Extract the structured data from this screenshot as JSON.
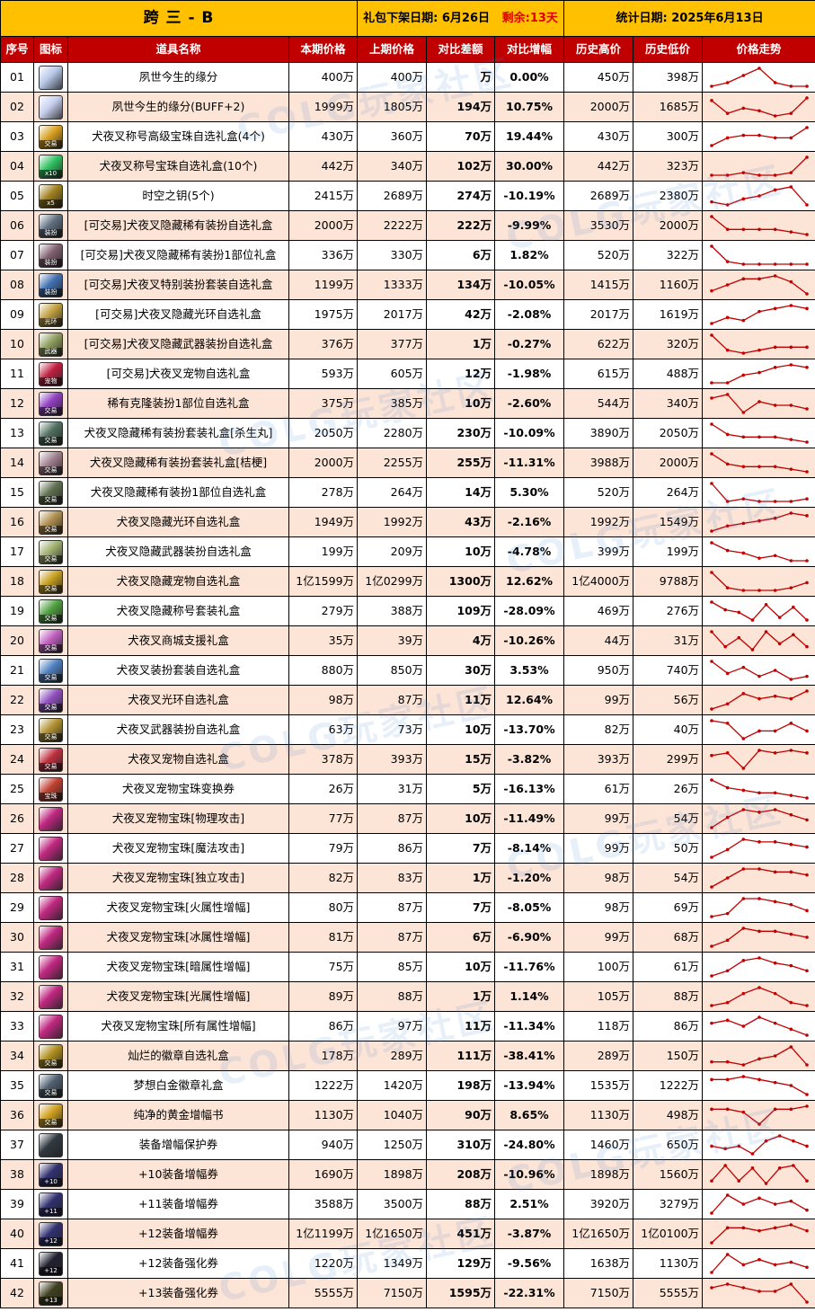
{
  "header": {
    "server": "跨 三 - B",
    "offline_label": "礼包下架日期:",
    "offline_date": "6月26日",
    "remaining_label": "剩余:",
    "remaining_value": "13天",
    "stat_label": "统计日期:",
    "stat_date": "2025年6月13日"
  },
  "columns": [
    "序号",
    "图标",
    "道具名称",
    "本期价格",
    "上期价格",
    "对比差额",
    "对比增幅",
    "历史高价",
    "历史低价",
    "价格走势"
  ],
  "watermark": "COLG玩家社区",
  "rows": [
    {
      "no": "01",
      "icon": "soul-bond-icon",
      "icon_color": "#b8c8e8",
      "tag": "",
      "name": "夙世今生的缘分",
      "cur": "400万",
      "prev": "400万",
      "diff": "万",
      "pct": "0.00%",
      "dir": "pos",
      "high": "450万",
      "low": "398万",
      "trend": [
        3,
        4,
        6,
        8,
        4,
        3,
        3
      ]
    },
    {
      "no": "02",
      "icon": "soul-bond-icon",
      "icon_color": "#c8d0f0",
      "tag": "",
      "name": "夙世今生的缘分(BUFF+2)",
      "cur": "1999万",
      "prev": "1805万",
      "diff": "194万",
      "pct": "10.75%",
      "dir": "pos",
      "high": "2000万",
      "low": "1685万",
      "trend": [
        8,
        3,
        5,
        4,
        2,
        3,
        9
      ]
    },
    {
      "no": "03",
      "icon": "title-gem-box-icon",
      "icon_color": "#d8a020",
      "tag": "交易",
      "name": "犬夜叉称号高级宝珠自选礼盒(4个)",
      "cur": "430万",
      "prev": "360万",
      "diff": "70万",
      "pct": "19.44%",
      "dir": "pos",
      "high": "430万",
      "low": "300万",
      "trend": [
        2,
        5,
        6,
        6,
        5,
        5,
        9
      ]
    },
    {
      "no": "04",
      "icon": "title-gem-box-icon",
      "icon_color": "#30c060",
      "tag": "x10",
      "name": "犬夜叉称号宝珠自选礼盒(10个)",
      "cur": "442万",
      "prev": "340万",
      "diff": "102万",
      "pct": "30.00%",
      "dir": "pos",
      "high": "442万",
      "low": "323万",
      "trend": [
        2,
        2,
        3,
        2,
        2,
        3,
        9
      ]
    },
    {
      "no": "05",
      "icon": "time-key-icon",
      "icon_color": "#a08020",
      "tag": "x5",
      "name": "时空之钥(5个)",
      "cur": "2415万",
      "prev": "2689万",
      "diff": "274万",
      "pct": "-10.19%",
      "dir": "neg",
      "high": "2689万",
      "low": "2380万",
      "trend": [
        3,
        2,
        4,
        5,
        7,
        8,
        2
      ]
    },
    {
      "no": "06",
      "icon": "rare-avatar-box-icon",
      "icon_color": "#607080",
      "tag": "装扮",
      "name": "[可交易]犬夜叉隐藏稀有装扮自选礼盒",
      "cur": "2000万",
      "prev": "2222万",
      "diff": "222万",
      "pct": "-9.99%",
      "dir": "neg",
      "high": "3530万",
      "low": "2000万",
      "trend": [
        9,
        4,
        4,
        4,
        4,
        3,
        2
      ]
    },
    {
      "no": "07",
      "icon": "rare-avatar-part-icon",
      "icon_color": "#806070",
      "tag": "装扮",
      "name": "[可交易]犬夜叉隐藏稀有装扮1部位礼盒",
      "cur": "336万",
      "prev": "330万",
      "diff": "6万",
      "pct": "1.82%",
      "dir": "pos",
      "high": "520万",
      "low": "322万",
      "trend": [
        9,
        3,
        2,
        2,
        2,
        2,
        2
      ]
    },
    {
      "no": "08",
      "icon": "special-avatar-box-icon",
      "icon_color": "#4070b0",
      "tag": "装扮",
      "name": "[可交易]犬夜叉特别装扮套装自选礼盒",
      "cur": "1199万",
      "prev": "1333万",
      "diff": "134万",
      "pct": "-10.05%",
      "dir": "neg",
      "high": "1415万",
      "low": "1160万",
      "trend": [
        3,
        5,
        7,
        7,
        8,
        6,
        2
      ]
    },
    {
      "no": "09",
      "icon": "aura-box-icon",
      "icon_color": "#c0a040",
      "tag": "光环",
      "name": "[可交易]犬夜叉隐藏光环自选礼盒",
      "cur": "1975万",
      "prev": "2017万",
      "diff": "42万",
      "pct": "-2.08%",
      "dir": "neg",
      "high": "2017万",
      "low": "1619万",
      "trend": [
        2,
        4,
        3,
        6,
        7,
        8,
        7
      ]
    },
    {
      "no": "10",
      "icon": "weapon-avatar-box-icon",
      "icon_color": "#90a060",
      "tag": "武器",
      "name": "[可交易]犬夜叉隐藏武器装扮自选礼盒",
      "cur": "376万",
      "prev": "377万",
      "diff": "1万",
      "pct": "-0.27%",
      "dir": "neg",
      "high": "622万",
      "low": "320万",
      "trend": [
        8,
        3,
        2,
        3,
        4,
        4,
        4
      ]
    },
    {
      "no": "11",
      "icon": "pet-box-icon",
      "icon_color": "#c02040",
      "tag": "宠物",
      "name": "[可交易]犬夜叉宠物自选礼盒",
      "cur": "593万",
      "prev": "605万",
      "diff": "12万",
      "pct": "-1.98%",
      "dir": "neg",
      "high": "615万",
      "low": "488万",
      "trend": [
        2,
        2,
        5,
        6,
        8,
        9,
        8
      ]
    },
    {
      "no": "12",
      "icon": "rare-clone-box-icon",
      "icon_color": "#9040c0",
      "tag": "交易",
      "name": "稀有克隆装扮1部位自选礼盒",
      "cur": "375万",
      "prev": "385万",
      "diff": "10万",
      "pct": "-2.60%",
      "dir": "neg",
      "high": "544万",
      "low": "340万",
      "trend": [
        6,
        7,
        2,
        5,
        4,
        4,
        3
      ]
    },
    {
      "no": "13",
      "icon": "rare-avatar-set-icon",
      "icon_color": "#507060",
      "tag": "交易",
      "name": "犬夜叉隐藏稀有装扮套装礼盒[杀生丸]",
      "cur": "2050万",
      "prev": "2280万",
      "diff": "230万",
      "pct": "-10.09%",
      "dir": "neg",
      "high": "3890万",
      "low": "2050万",
      "trend": [
        9,
        5,
        4,
        4,
        4,
        3,
        2
      ]
    },
    {
      "no": "14",
      "icon": "rare-avatar-set-icon",
      "icon_color": "#a08090",
      "tag": "交易",
      "name": "犬夜叉隐藏稀有装扮套装礼盒[桔梗]",
      "cur": "2000万",
      "prev": "2255万",
      "diff": "255万",
      "pct": "-11.31%",
      "dir": "neg",
      "high": "3988万",
      "low": "2000万",
      "trend": [
        9,
        5,
        4,
        4,
        4,
        3,
        2
      ]
    },
    {
      "no": "15",
      "icon": "rare-avatar-part-icon",
      "icon_color": "#607050",
      "tag": "交易",
      "name": "犬夜叉隐藏稀有装扮1部位自选礼盒",
      "cur": "278万",
      "prev": "264万",
      "diff": "14万",
      "pct": "5.30%",
      "dir": "pos",
      "high": "520万",
      "low": "264万",
      "trend": [
        9,
        2,
        3,
        2,
        2,
        2,
        3
      ]
    },
    {
      "no": "16",
      "icon": "aura-box-icon",
      "icon_color": "#b09050",
      "tag": "交易",
      "name": "犬夜叉隐藏光环自选礼盒",
      "cur": "1949万",
      "prev": "1992万",
      "diff": "43万",
      "pct": "-2.16%",
      "dir": "neg",
      "high": "1992万",
      "low": "1549万",
      "trend": [
        2,
        4,
        5,
        6,
        7,
        9,
        8
      ]
    },
    {
      "no": "17",
      "icon": "weapon-avatar-box-icon",
      "icon_color": "#a0b070",
      "tag": "交易",
      "name": "犬夜叉隐藏武器装扮自选礼盒",
      "cur": "199万",
      "prev": "209万",
      "diff": "10万",
      "pct": "-4.78%",
      "dir": "neg",
      "high": "399万",
      "low": "199万",
      "trend": [
        9,
        6,
        5,
        3,
        4,
        2,
        2
      ]
    },
    {
      "no": "18",
      "icon": "pet-box-icon",
      "icon_color": "#c8a020",
      "tag": "交易",
      "name": "犬夜叉隐藏宠物自选礼盒",
      "cur": "1亿1599万",
      "prev": "1亿0299万",
      "diff": "1300万",
      "pct": "12.62%",
      "dir": "pos",
      "high": "1亿4000万",
      "low": "9788万",
      "trend": [
        9,
        3,
        2,
        2,
        2,
        3,
        5
      ]
    },
    {
      "no": "19",
      "icon": "title-set-box-icon",
      "icon_color": "#50a040",
      "tag": "交易",
      "name": "犬夜叉隐藏称号套装礼盒",
      "cur": "279万",
      "prev": "388万",
      "diff": "109万",
      "pct": "-28.09%",
      "dir": "neg",
      "high": "469万",
      "low": "276万",
      "trend": [
        9,
        6,
        5,
        2,
        8,
        3,
        7,
        2
      ]
    },
    {
      "no": "20",
      "icon": "mall-support-box-icon",
      "icon_color": "#c060c0",
      "tag": "交易",
      "name": "犬夜叉商城支援礼盒",
      "cur": "35万",
      "prev": "39万",
      "diff": "4万",
      "pct": "-10.26%",
      "dir": "neg",
      "high": "44万",
      "low": "31万",
      "trend": [
        8,
        3,
        6,
        2,
        8,
        4,
        7,
        3
      ]
    },
    {
      "no": "21",
      "icon": "avatar-set-box-icon",
      "icon_color": "#5080c0",
      "tag": "交易",
      "name": "犬夜叉装扮套装自选礼盒",
      "cur": "880万",
      "prev": "850万",
      "diff": "30万",
      "pct": "3.53%",
      "dir": "pos",
      "high": "950万",
      "low": "740万",
      "trend": [
        9,
        5,
        7,
        4,
        6,
        3,
        4
      ]
    },
    {
      "no": "22",
      "icon": "aura-box-icon",
      "icon_color": "#9050c0",
      "tag": "交易",
      "name": "犬夜叉光环自选礼盒",
      "cur": "98万",
      "prev": "87万",
      "diff": "11万",
      "pct": "12.64%",
      "dir": "pos",
      "high": "99万",
      "low": "56万",
      "trend": [
        2,
        4,
        8,
        6,
        7,
        6,
        9
      ]
    },
    {
      "no": "23",
      "icon": "weapon-avatar-box-icon",
      "icon_color": "#b09030",
      "tag": "交易",
      "name": "犬夜叉武器装扮自选礼盒",
      "cur": "63万",
      "prev": "73万",
      "diff": "10万",
      "pct": "-13.70%",
      "dir": "neg",
      "high": "82万",
      "low": "40万",
      "trend": [
        9,
        8,
        2,
        5,
        5,
        8,
        5
      ]
    },
    {
      "no": "24",
      "icon": "pet-box-icon",
      "icon_color": "#c03040",
      "tag": "交易",
      "name": "犬夜叉宠物自选礼盒",
      "cur": "378万",
      "prev": "393万",
      "diff": "15万",
      "pct": "-3.82%",
      "dir": "neg",
      "high": "393万",
      "low": "299万",
      "trend": [
        7,
        8,
        2,
        9,
        8,
        9,
        8
      ]
    },
    {
      "no": "25",
      "icon": "pet-gem-ticket-icon",
      "icon_color": "#c04030",
      "tag": "宝珠",
      "name": "犬夜叉宠物宝珠变换券",
      "cur": "26万",
      "prev": "31万",
      "diff": "5万",
      "pct": "-16.13%",
      "dir": "neg",
      "high": "61万",
      "low": "26万",
      "trend": [
        9,
        6,
        5,
        4,
        4,
        3,
        2
      ]
    },
    {
      "no": "26",
      "icon": "pet-gem-icon",
      "icon_color": "#c02880",
      "tag": "",
      "name": "犬夜叉宠物宝珠[物理攻击]",
      "cur": "77万",
      "prev": "87万",
      "diff": "10万",
      "pct": "-11.49%",
      "dir": "neg",
      "high": "99万",
      "low": "54万",
      "trend": [
        2,
        6,
        9,
        8,
        9,
        7,
        5
      ]
    },
    {
      "no": "27",
      "icon": "pet-gem-icon",
      "icon_color": "#c02880",
      "tag": "",
      "name": "犬夜叉宠物宝珠[魔法攻击]",
      "cur": "79万",
      "prev": "86万",
      "diff": "7万",
      "pct": "-8.14%",
      "dir": "neg",
      "high": "99万",
      "low": "50万",
      "trend": [
        2,
        5,
        9,
        8,
        8,
        7,
        6
      ]
    },
    {
      "no": "28",
      "icon": "pet-gem-icon",
      "icon_color": "#c02880",
      "tag": "",
      "name": "犬夜叉宠物宝珠[独立攻击]",
      "cur": "82万",
      "prev": "83万",
      "diff": "1万",
      "pct": "-1.20%",
      "dir": "neg",
      "high": "98万",
      "low": "54万",
      "trend": [
        2,
        5,
        8,
        8,
        7,
        7,
        6
      ]
    },
    {
      "no": "29",
      "icon": "pet-gem-icon",
      "icon_color": "#c02880",
      "tag": "",
      "name": "犬夜叉宠物宝珠[火属性增幅]",
      "cur": "80万",
      "prev": "87万",
      "diff": "7万",
      "pct": "-8.05%",
      "dir": "neg",
      "high": "98万",
      "low": "69万",
      "trend": [
        2,
        3,
        8,
        8,
        7,
        6,
        4
      ]
    },
    {
      "no": "30",
      "icon": "pet-gem-icon",
      "icon_color": "#c02880",
      "tag": "",
      "name": "犬夜叉宠物宝珠[冰属性增幅]",
      "cur": "81万",
      "prev": "87万",
      "diff": "6万",
      "pct": "-6.90%",
      "dir": "neg",
      "high": "99万",
      "low": "68万",
      "trend": [
        2,
        4,
        8,
        7,
        7,
        6,
        5
      ]
    },
    {
      "no": "31",
      "icon": "pet-gem-icon",
      "icon_color": "#c02880",
      "tag": "",
      "name": "犬夜叉宠物宝珠[暗属性增幅]",
      "cur": "75万",
      "prev": "85万",
      "diff": "10万",
      "pct": "-11.76%",
      "dir": "neg",
      "high": "100万",
      "low": "61万",
      "trend": [
        2,
        4,
        8,
        9,
        7,
        6,
        4
      ]
    },
    {
      "no": "32",
      "icon": "pet-gem-icon",
      "icon_color": "#c02880",
      "tag": "",
      "name": "犬夜叉宠物宝珠[光属性增幅]",
      "cur": "89万",
      "prev": "88万",
      "diff": "1万",
      "pct": "1.14%",
      "dir": "pos",
      "high": "105万",
      "low": "88万",
      "trend": [
        2,
        3,
        6,
        8,
        6,
        3,
        2
      ]
    },
    {
      "no": "33",
      "icon": "pet-gem-icon",
      "icon_color": "#c02880",
      "tag": "",
      "name": "犬夜叉宠物宝珠[所有属性增幅]",
      "cur": "86万",
      "prev": "97万",
      "diff": "11万",
      "pct": "-11.34%",
      "dir": "neg",
      "high": "118万",
      "low": "86万",
      "trend": [
        6,
        7,
        5,
        8,
        6,
        4,
        2
      ]
    },
    {
      "no": "34",
      "icon": "emblem-box-icon",
      "icon_color": "#b09020",
      "tag": "交易",
      "name": "灿烂的徽章自选礼盒",
      "cur": "178万",
      "prev": "289万",
      "diff": "111万",
      "pct": "-38.41%",
      "dir": "neg",
      "high": "289万",
      "low": "150万",
      "trend": [
        3,
        3,
        2,
        4,
        5,
        8,
        2
      ]
    },
    {
      "no": "35",
      "icon": "platinum-emblem-icon",
      "icon_color": "#506070",
      "tag": "交易",
      "name": "梦想白金徽章礼盒",
      "cur": "1222万",
      "prev": "1420万",
      "diff": "198万",
      "pct": "-13.94%",
      "dir": "neg",
      "high": "1535万",
      "low": "1222万",
      "trend": [
        7,
        7,
        8,
        7,
        6,
        5,
        2
      ]
    },
    {
      "no": "36",
      "icon": "amplify-book-icon",
      "icon_color": "#d0a020",
      "tag": "交易",
      "name": "纯净的黄金增幅书",
      "cur": "1130万",
      "prev": "1040万",
      "diff": "90万",
      "pct": "8.65%",
      "dir": "pos",
      "high": "1130万",
      "low": "498万",
      "trend": [
        7,
        7,
        6,
        2,
        7,
        7,
        8
      ]
    },
    {
      "no": "37",
      "icon": "amplify-protect-icon",
      "icon_color": "#303840",
      "tag": "",
      "name": "装备增幅保护券",
      "cur": "940万",
      "prev": "1250万",
      "diff": "310万",
      "pct": "-24.80%",
      "dir": "neg",
      "high": "1460万",
      "low": "650万",
      "trend": [
        5,
        4,
        5,
        2,
        7,
        9,
        7,
        5
      ]
    },
    {
      "no": "38",
      "icon": "amplify-ticket-10-icon",
      "icon_color": "#303070",
      "tag": "+10",
      "name": "+10装备增幅券",
      "cur": "1690万",
      "prev": "1898万",
      "diff": "208万",
      "pct": "-10.96%",
      "dir": "neg",
      "high": "1898万",
      "low": "1560万",
      "trend": [
        3,
        9,
        3,
        8,
        2,
        8,
        9,
        3
      ]
    },
    {
      "no": "39",
      "icon": "amplify-ticket-11-icon",
      "icon_color": "#303070",
      "tag": "+11",
      "name": "+11装备增幅券",
      "cur": "3588万",
      "prev": "3500万",
      "diff": "88万",
      "pct": "2.51%",
      "dir": "pos",
      "high": "3920万",
      "low": "3279万",
      "trend": [
        2,
        8,
        5,
        7,
        5,
        6,
        3
      ]
    },
    {
      "no": "40",
      "icon": "amplify-ticket-12-icon",
      "icon_color": "#303070",
      "tag": "+12",
      "name": "+12装备增幅券",
      "cur": "1亿1199万",
      "prev": "1亿1650万",
      "diff": "451万",
      "pct": "-3.87%",
      "dir": "neg",
      "high": "1亿1650万",
      "low": "1亿0100万",
      "trend": [
        2,
        7,
        7,
        6,
        7,
        8,
        6
      ]
    },
    {
      "no": "41",
      "icon": "reinforce-ticket-12-icon",
      "icon_color": "#202030",
      "tag": "+12",
      "name": "+12装备强化券",
      "cur": "1220万",
      "prev": "1349万",
      "diff": "129万",
      "pct": "-9.56%",
      "dir": "neg",
      "high": "1638万",
      "low": "1130万",
      "trend": [
        2,
        9,
        5,
        7,
        5,
        6,
        4
      ]
    },
    {
      "no": "42",
      "icon": "reinforce-ticket-13-icon",
      "icon_color": "#404020",
      "tag": "+13",
      "name": "+13装备强化券",
      "cur": "5555万",
      "prev": "7150万",
      "diff": "1595万",
      "pct": "-22.31%",
      "dir": "neg",
      "high": "7150万",
      "low": "5555万",
      "trend": [
        6,
        7,
        6,
        5,
        5,
        7,
        2
      ]
    }
  ]
}
